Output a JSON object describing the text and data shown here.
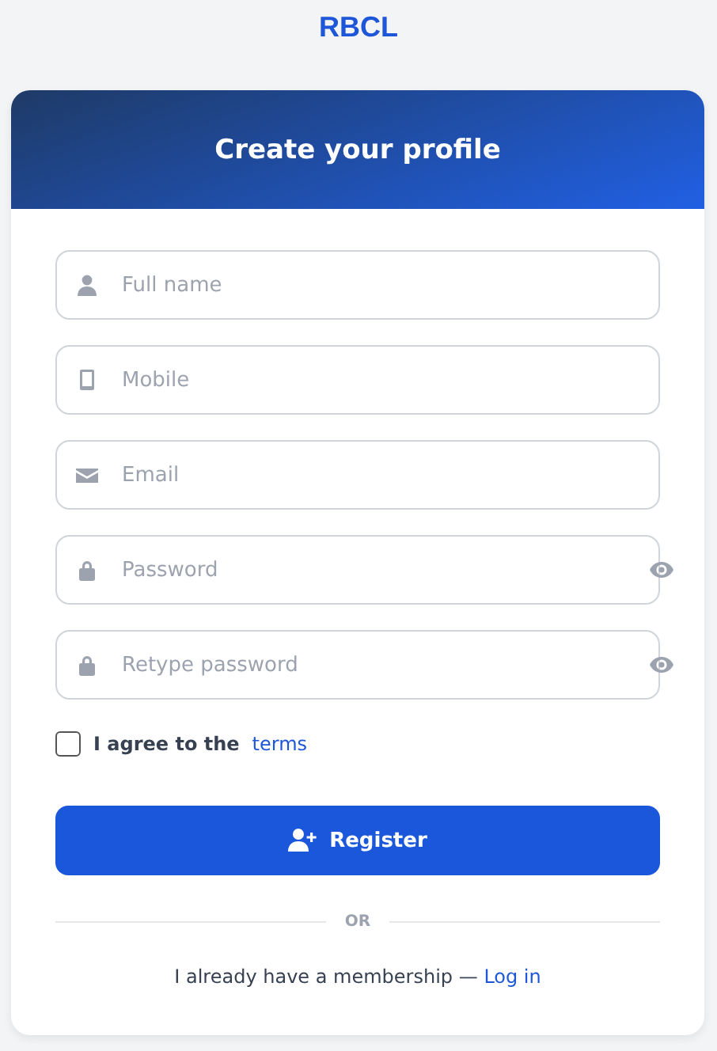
{
  "logo": "RBCL",
  "header": {
    "title": "Create your profile"
  },
  "fields": [
    {
      "kind": "person",
      "placeholder": "Full name",
      "reveal": false
    },
    {
      "kind": "phone",
      "placeholder": "Mobile",
      "reveal": false
    },
    {
      "kind": "mail",
      "placeholder": "Email",
      "reveal": false
    },
    {
      "kind": "lock",
      "placeholder": "Password",
      "reveal": true
    },
    {
      "kind": "lock",
      "placeholder": "Retype password",
      "reveal": true
    }
  ],
  "agree": {
    "label": "I agree to the",
    "link": "terms",
    "checked": false
  },
  "submit": {
    "label": "Register"
  },
  "divider": "OR",
  "login": {
    "text": "I already have a membership —",
    "link": "Log in"
  }
}
